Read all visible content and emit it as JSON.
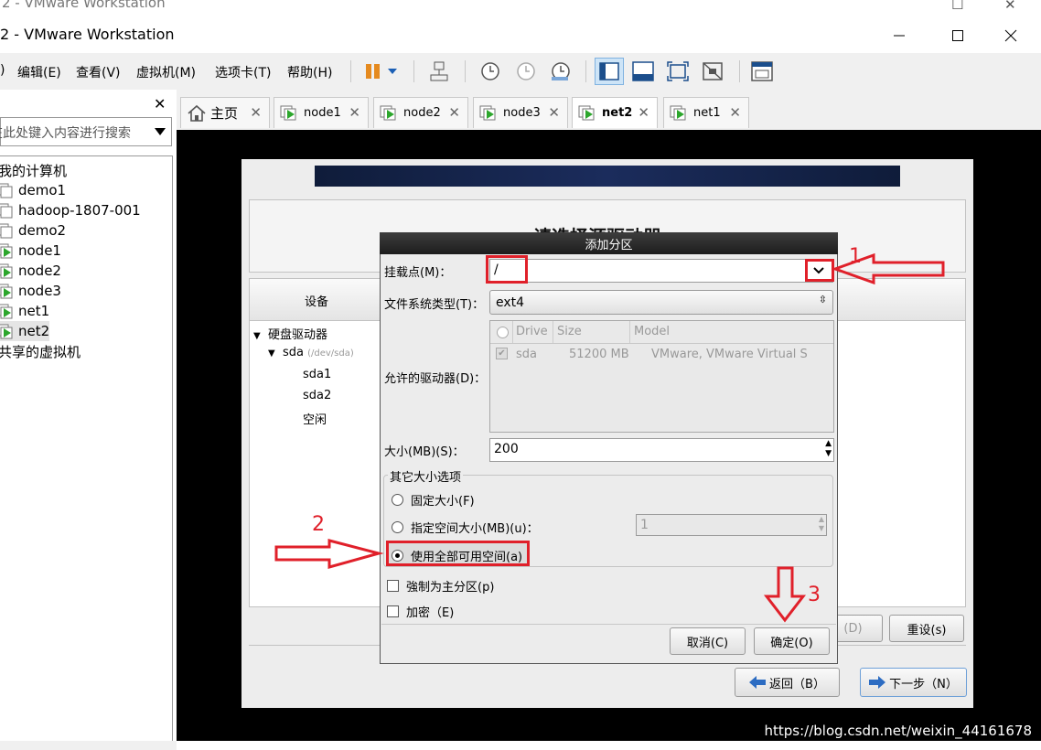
{
  "window": {
    "ghost_title": "2 - VMware Workstation",
    "title": "2 - VMware Workstation"
  },
  "menubar": {
    "items": [
      "编辑(E)",
      "查看(V)",
      "虚拟机(M)",
      "选项卡(T)",
      "帮助(H)"
    ]
  },
  "library": {
    "search_placeholder": "在此处键入内容进行搜索",
    "root": "我的计算机",
    "vms": [
      "demo1",
      "hadoop-1807-001",
      "demo2",
      "node1",
      "node2",
      "node3",
      "net1",
      "net2"
    ],
    "shared": "共享的虚拟机",
    "selected": "net2"
  },
  "tabs": [
    "主页",
    "node1",
    "node2",
    "node3",
    "net2",
    "net1"
  ],
  "active_tab": "net2",
  "installer": {
    "heading": "请选择源驱动器",
    "device_col": "设备",
    "tree": {
      "hard_drives": "硬盘驱动器",
      "sda": "sda",
      "sda_path": "(/dev/sda)",
      "parts": [
        "sda1",
        "sda2",
        "空闲"
      ]
    },
    "delete_btn": "(D)",
    "reset_btn": "重设(s)",
    "back_btn": "返回（B）",
    "next_btn": "下一步（N）"
  },
  "dialog": {
    "title": "添加分区",
    "mount_label": "挂载点(M)：",
    "mount_value": "/",
    "fs_label": "文件系统类型(T)：",
    "fs_value": "ext4",
    "drives_label": "允许的驱动器(D)：",
    "drive_headers": [
      "Drive",
      "Size",
      "Model"
    ],
    "drive_row": {
      "drive": "sda",
      "size": "51200 MB",
      "model": "VMware, VMware Virtual S"
    },
    "size_label": "大小(MB)(S)：",
    "size_value": "200",
    "other_size_title": "其它大小选项",
    "opt_fixed": "固定大小(F)",
    "opt_upto": "指定空间大小(MB)(u)：",
    "opt_upto_value": "1",
    "opt_fill": "使用全部可用空间(a)",
    "force_primary": "強制为主分区(p)",
    "encrypt": "加密（E)",
    "cancel": "取消(C)",
    "ok": "确定(O)"
  },
  "annotations": {
    "n1": "1",
    "n2": "2",
    "n3": "3",
    "color": "#e0202a"
  },
  "watermark": "https://blog.csdn.net/weixin_44161678"
}
